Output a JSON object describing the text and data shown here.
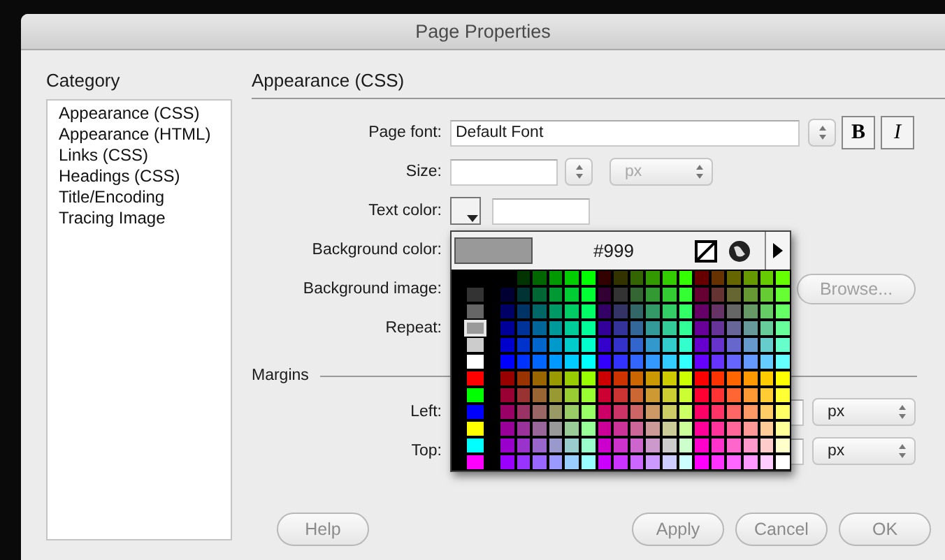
{
  "window": {
    "title": "Page Properties"
  },
  "category": {
    "label": "Category",
    "items": [
      {
        "label": "Appearance (CSS)",
        "selected": false
      },
      {
        "label": "Appearance (HTML)",
        "selected": false
      },
      {
        "label": "Links (CSS)",
        "selected": false
      },
      {
        "label": "Headings (CSS)",
        "selected": false
      },
      {
        "label": "Title/Encoding",
        "selected": false
      },
      {
        "label": "Tracing Image",
        "selected": false
      }
    ]
  },
  "section": {
    "title": "Appearance (CSS)"
  },
  "page_font": {
    "label": "Page font:",
    "value": "Default Font",
    "bold": "B",
    "italic": "I"
  },
  "size": {
    "label": "Size:",
    "unit": "px",
    "unit_disabled": true
  },
  "text_color": {
    "label": "Text color:"
  },
  "background_color": {
    "label": "Background color:"
  },
  "background_image": {
    "label": "Background image:",
    "button": "Browse...",
    "button_disabled": true
  },
  "repeat": {
    "label": "Repeat:"
  },
  "margins": {
    "title": "Margins",
    "rows": [
      {
        "label": "Left:",
        "unit": "px"
      },
      {
        "label": "Top:",
        "unit": "px"
      }
    ]
  },
  "color_picker": {
    "hex": "#999",
    "side_swatches": [
      {
        "color": "#333333",
        "selected": false
      },
      {
        "color": "#666666",
        "selected": false
      },
      {
        "color": "#999999",
        "selected": true
      },
      {
        "color": "#cccccc",
        "selected": false
      },
      {
        "color": "#ffffff",
        "selected": false
      },
      {
        "color": "#ff0000",
        "selected": false
      },
      {
        "color": "#00ff00",
        "selected": false
      },
      {
        "color": "#0000ff",
        "selected": false
      },
      {
        "color": "#ffff00",
        "selected": false
      },
      {
        "color": "#00ffff",
        "selected": false
      },
      {
        "color": "#ff00ff",
        "selected": false
      }
    ]
  },
  "buttons": [
    {
      "label": "Help",
      "kind": "left"
    },
    {
      "label": "Apply",
      "kind": "right"
    },
    {
      "label": "Cancel",
      "kind": "right"
    },
    {
      "label": "OK",
      "kind": "right"
    }
  ]
}
